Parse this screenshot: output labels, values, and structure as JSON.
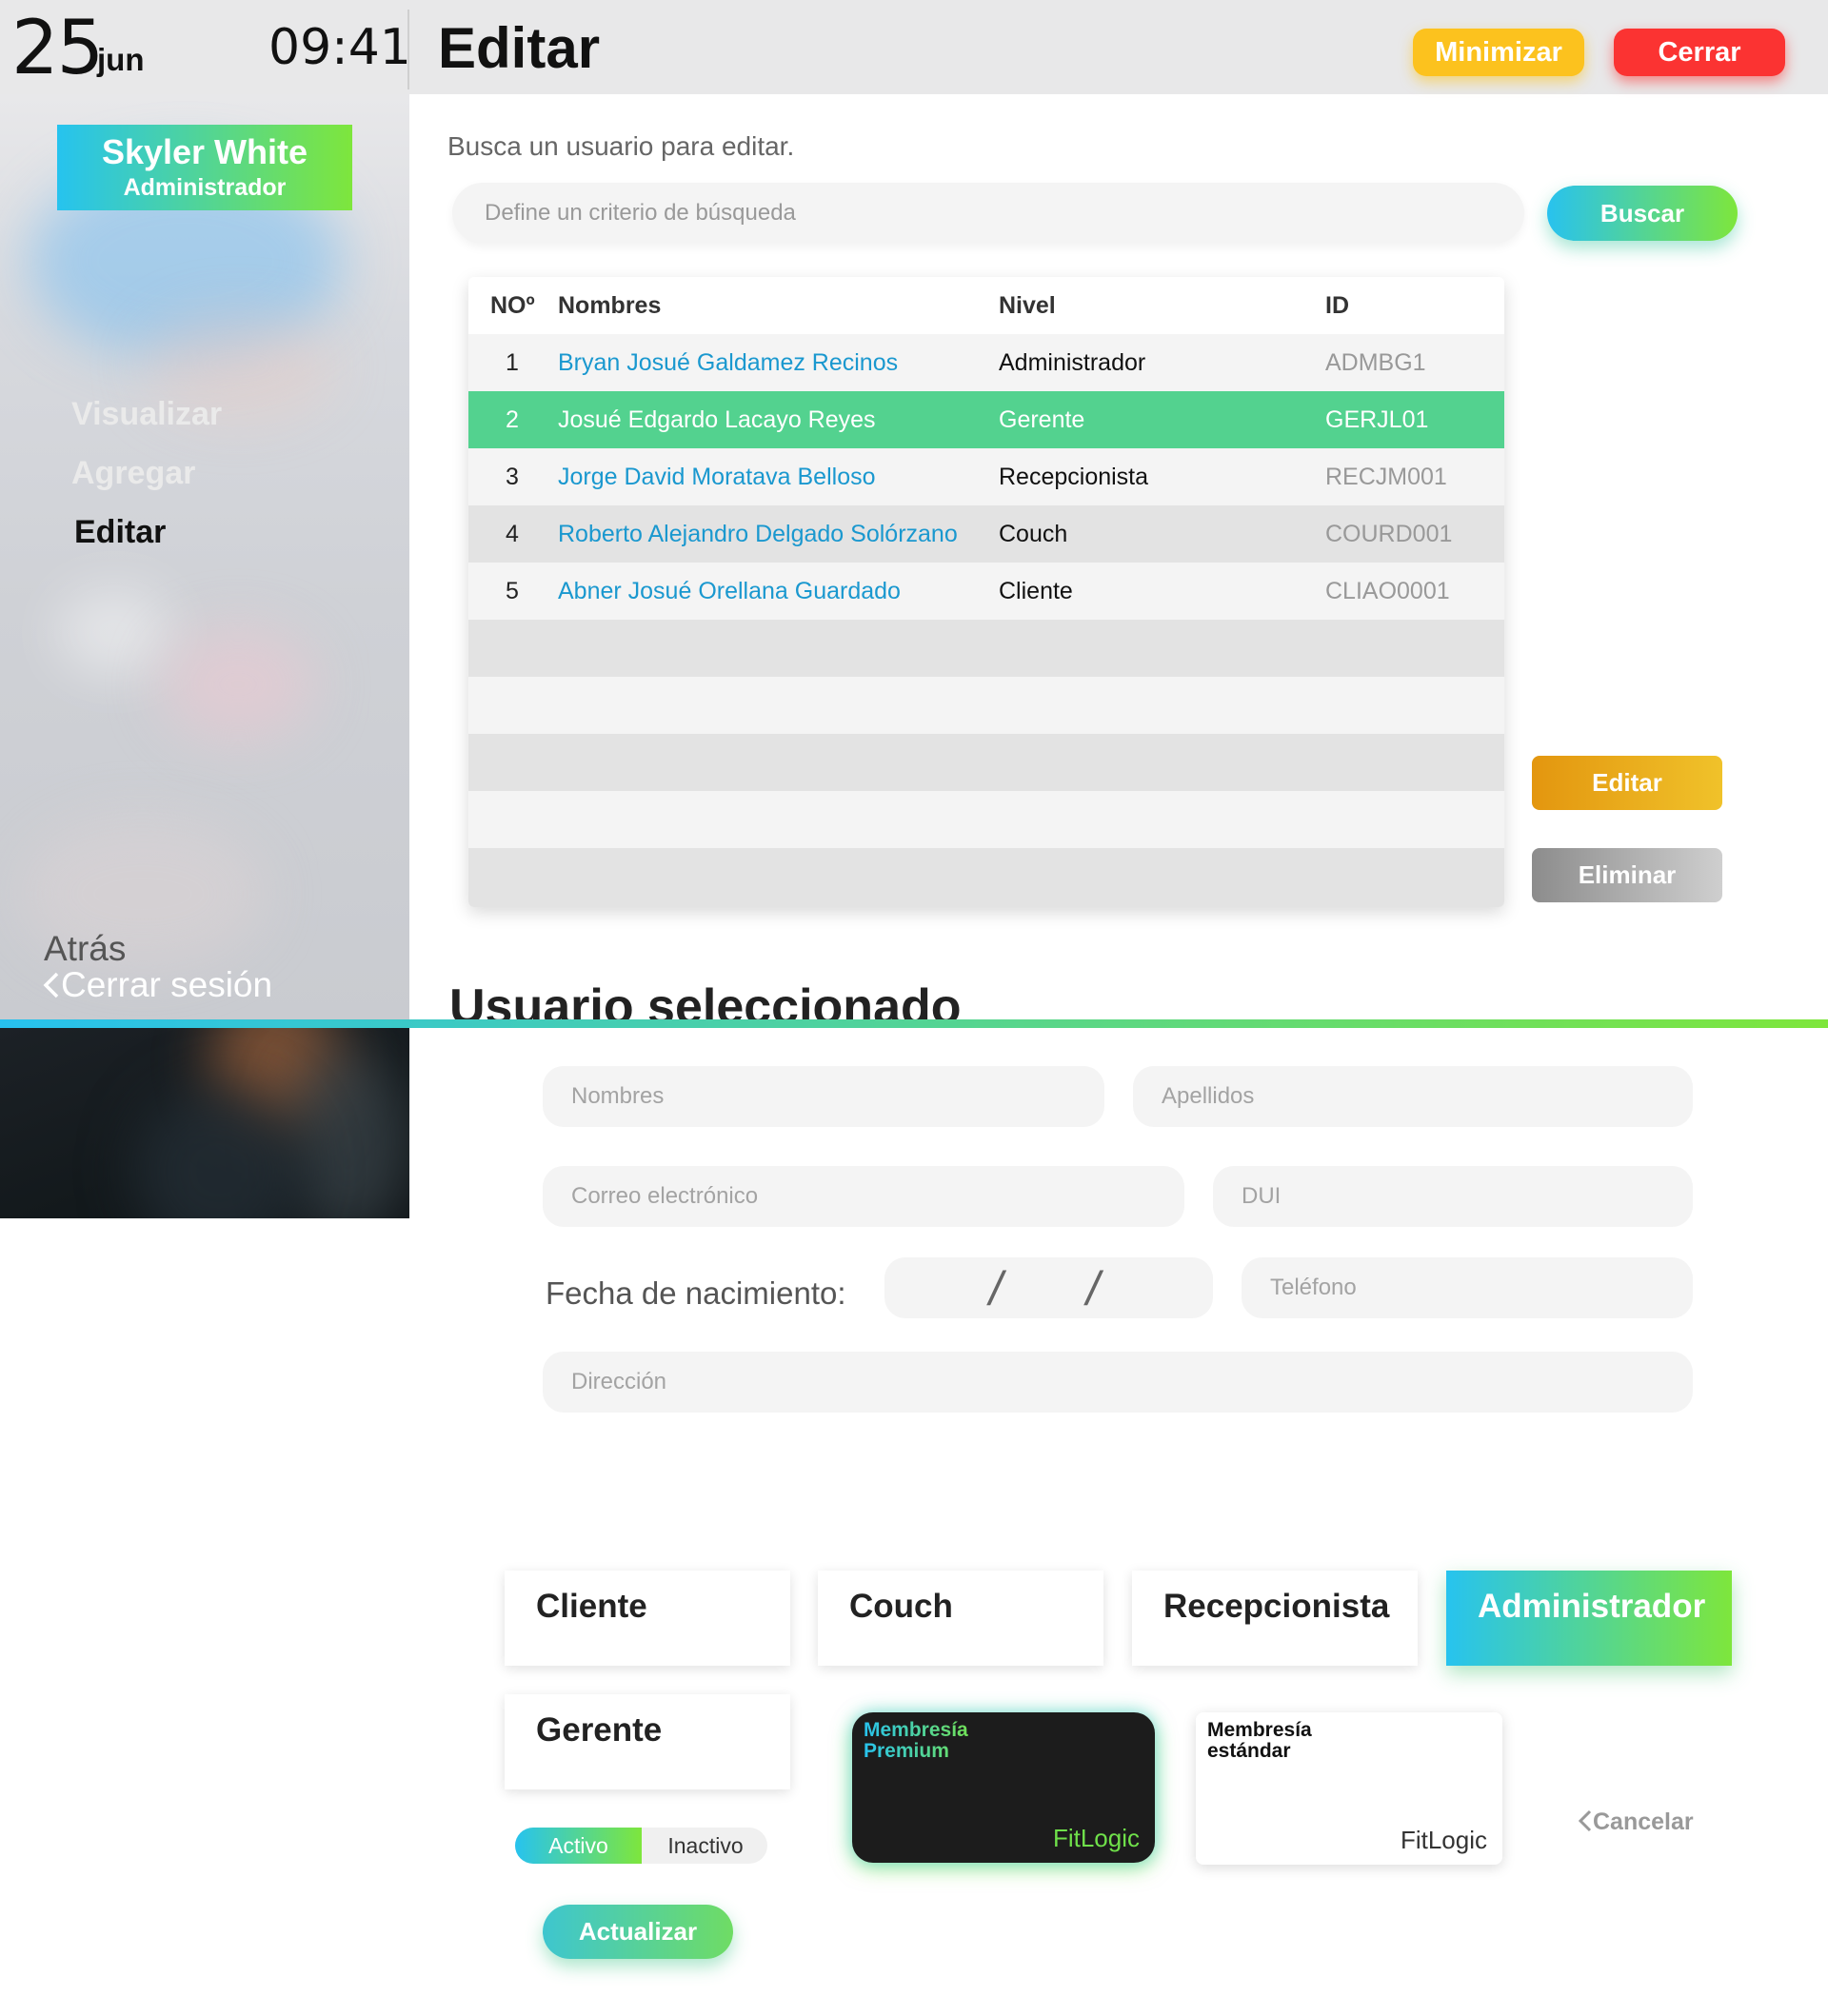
{
  "header": {
    "date_day": "25",
    "date_month": "jun",
    "time": "09:41",
    "title": "Editar",
    "minimize_label": "Minimizar",
    "close_label": "Cerrar"
  },
  "sidebar": {
    "user_name": "Skyler White",
    "user_role": "Administrador",
    "nav": [
      {
        "label": "Visualizar"
      },
      {
        "label": "Agregar"
      },
      {
        "label": "Editar"
      }
    ],
    "back_label": "Atrás",
    "logout_label": "Cerrar sesión"
  },
  "search": {
    "prompt": "Busca un usuario para editar.",
    "placeholder": "Define un criterio de búsqueda",
    "button_label": "Buscar"
  },
  "table": {
    "columns": [
      "NOº",
      "Nombres",
      "Nivel",
      "ID"
    ],
    "rows": [
      {
        "no": "1",
        "name": "Bryan Josué Galdamez Recinos",
        "level": "Administrador",
        "id": "ADMBG1"
      },
      {
        "no": "2",
        "name": "Josué Edgardo Lacayo Reyes",
        "level": "Gerente",
        "id": "GERJL01"
      },
      {
        "no": "3",
        "name": "Jorge David Moratava Belloso",
        "level": "Recepcionista",
        "id": "RECJM001"
      },
      {
        "no": "4",
        "name": "Roberto Alejandro Delgado Solórzano",
        "level": "Couch",
        "id": "COURD001"
      },
      {
        "no": "5",
        "name": "Abner Josué Orellana Guardado",
        "level": "Cliente",
        "id": "CLIAO0001"
      }
    ],
    "selected_row": 2
  },
  "actions": {
    "edit_label": "Editar",
    "delete_label": "Eliminar"
  },
  "selected_user": {
    "title": "Usuario seleccionado",
    "first_name_placeholder": "Nombres",
    "last_name_placeholder": "Apellidos",
    "email_placeholder": "Correo electrónico",
    "dui_placeholder": "DUI",
    "birth_label": "Fecha de nacimiento:",
    "birth_separator": "/",
    "phone_placeholder": "Teléfono",
    "address_placeholder": "Dirección"
  },
  "roles": {
    "options": [
      "Cliente",
      "Couch",
      "Recepcionista",
      "Administrador",
      "Gerente"
    ],
    "selected": "Administrador"
  },
  "membership": {
    "premium_title": "Membresía Premium",
    "premium_brand": "FitLogic",
    "standard_title": "Membresía estándar",
    "standard_brand": "FitLogic",
    "selected": "premium"
  },
  "status": {
    "active_label": "Activo",
    "inactive_label": "Inactivo",
    "selected": "Activo"
  },
  "footer": {
    "update_label": "Actualizar",
    "cancel_label": "Cancelar"
  },
  "colors": {
    "accent_gradient_start": "#27c1ef",
    "accent_gradient_end": "#7ee63c",
    "selected_row": "#53d28f",
    "minimize": "#fcc21e",
    "close": "#fb3332",
    "link": "#1a98cf"
  }
}
